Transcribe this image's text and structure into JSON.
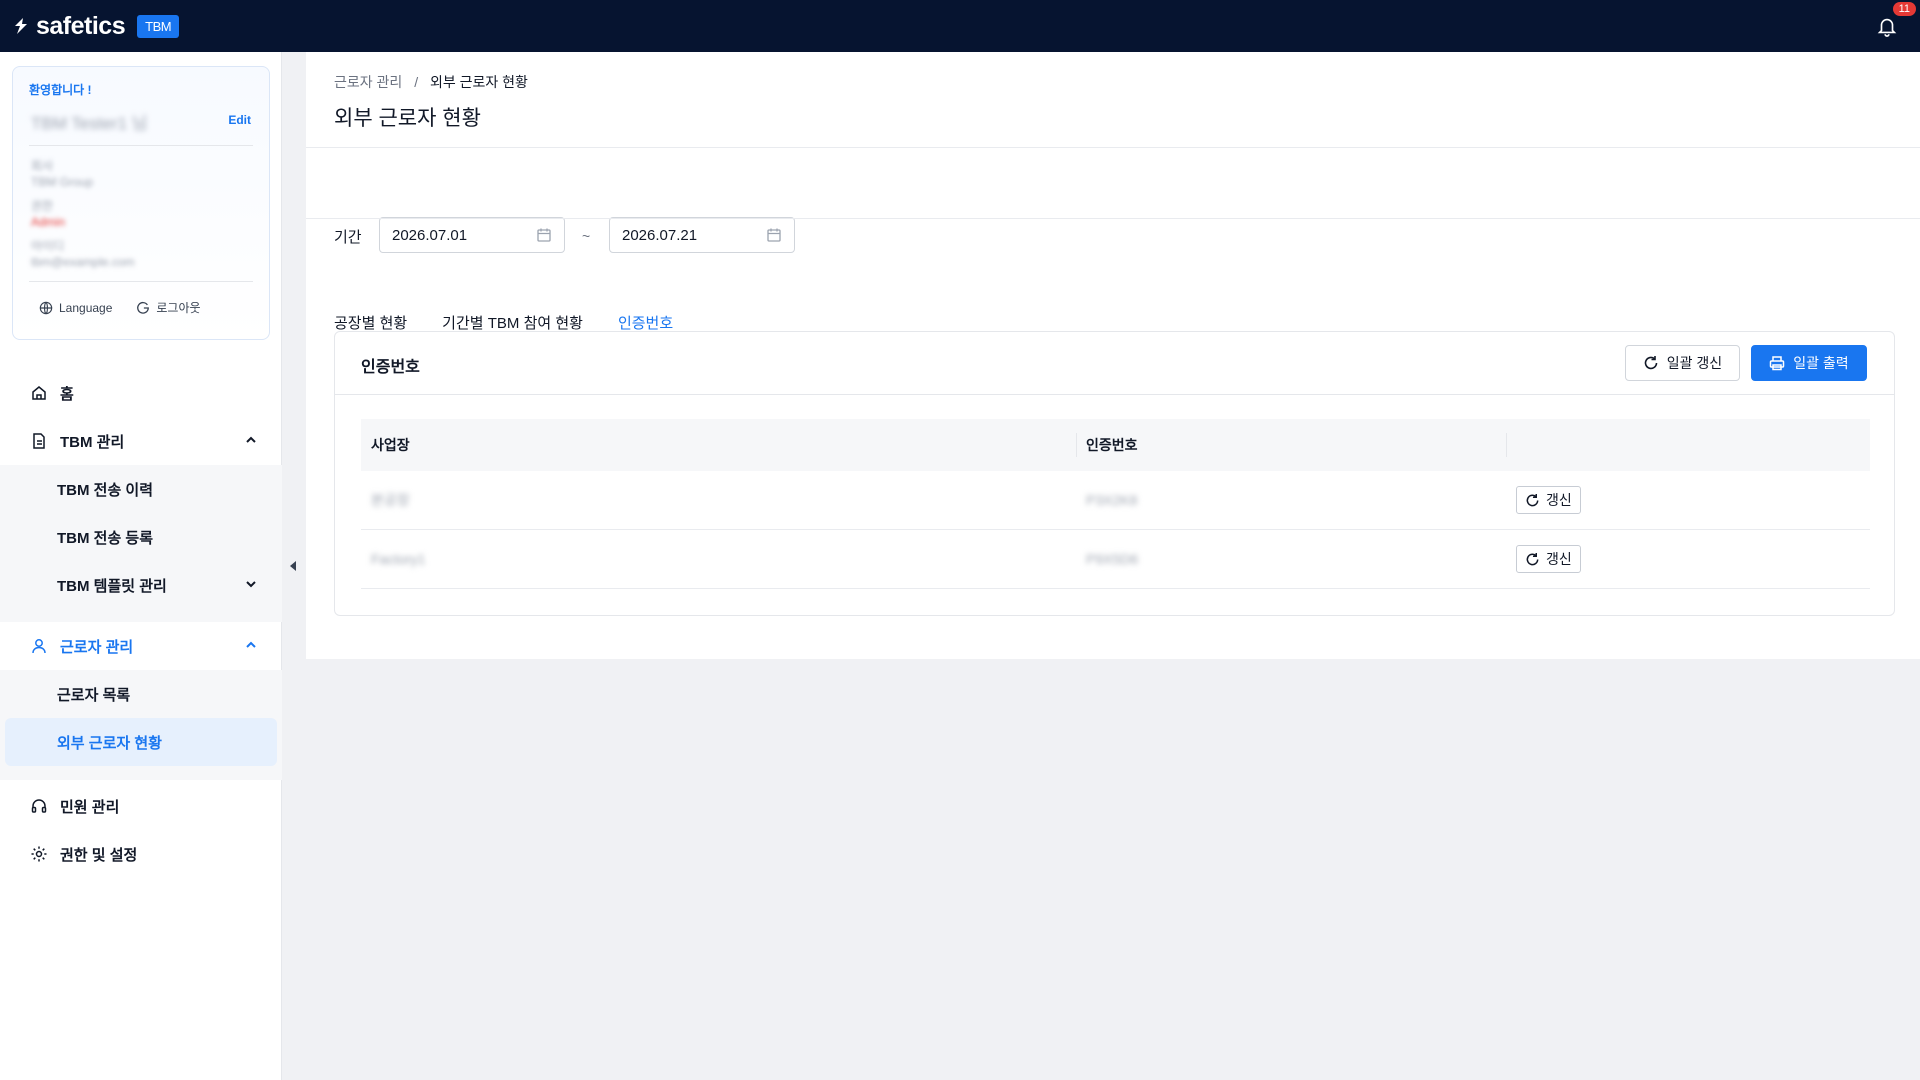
{
  "topbar": {
    "logo_text": "safetics",
    "badge": "TBM",
    "notification_count": "11"
  },
  "profile": {
    "welcome": "환영합니다 !",
    "name": "TBM Tester1 님",
    "edit": "Edit",
    "company_label": "회사",
    "company": "TBM Group",
    "role_label": "권한",
    "role": "Admin",
    "id_label": "아이디",
    "id": "tbm@example.com",
    "language": "Language",
    "logout": "로그아웃"
  },
  "nav": {
    "home": "홈",
    "tbm": "TBM 관리",
    "tbm_history": "TBM 전송 이력",
    "tbm_register": "TBM 전송 등록",
    "tbm_template": "TBM 템플릿 관리",
    "workers": "근로자 관리",
    "worker_list": "근로자 목록",
    "external_workers": "외부 근로자 현황",
    "complaints": "민원 관리",
    "settings": "권한 및 설정"
  },
  "breadcrumb": {
    "parent": "근로자 관리",
    "separator": "/",
    "current": "외부 근로자 현황"
  },
  "page_title": "외부 근로자 현황",
  "filter": {
    "period_label": "기간",
    "start_date": "2026.07.01",
    "tilde": "~",
    "end_date": "2026.07.21"
  },
  "tabs": [
    {
      "label": "공장별 현황",
      "active": false
    },
    {
      "label": "기간별 TBM 참여 현황",
      "active": false
    },
    {
      "label": "인증번호",
      "active": true
    }
  ],
  "panel": {
    "title": "인증번호",
    "bulk_refresh": "일괄 갱신",
    "bulk_print": "일괄 출력"
  },
  "table": {
    "columns": [
      "사업장",
      "인증번호",
      ""
    ],
    "rows": [
      {
        "site": "본공장",
        "code": "P3X2K8",
        "action": "갱신"
      },
      {
        "site": "Factory1",
        "code": "P9X5D6",
        "action": "갱신"
      }
    ]
  },
  "colors": {
    "accent": "#1976f0",
    "topbar": "#061430",
    "badge_red": "#e53935"
  }
}
